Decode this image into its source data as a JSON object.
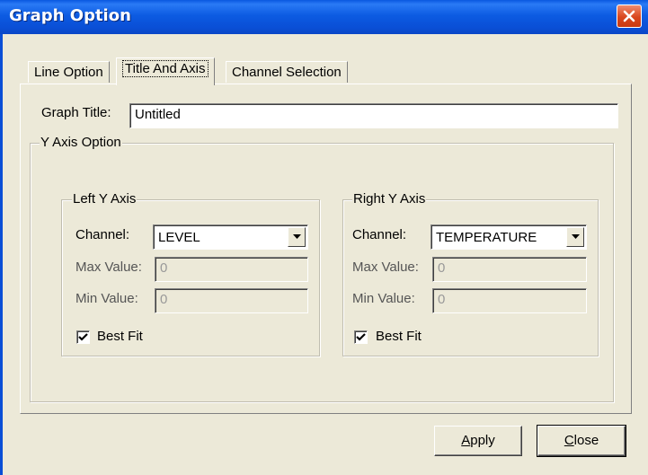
{
  "window": {
    "title": "Graph Option"
  },
  "tabs": [
    {
      "label": "Line Option",
      "active": false
    },
    {
      "label": "Title And Axis",
      "active": true
    },
    {
      "label": "Channel Selection",
      "active": false
    }
  ],
  "graph_title": {
    "label": "Graph Title:",
    "value": "Untitled"
  },
  "y_axis_option": {
    "label": "Y Axis Option",
    "left": {
      "label": "Left Y Axis",
      "channel_label": "Channel:",
      "channel_value": "LEVEL",
      "max_label": "Max Value:",
      "max_value": "0",
      "min_label": "Min Value:",
      "min_value": "0",
      "best_fit_label": "Best Fit",
      "best_fit_checked": true
    },
    "right": {
      "label": "Right Y Axis",
      "channel_label": "Channel:",
      "channel_value": "TEMPERATURE",
      "max_label": "Max Value:",
      "max_value": "0",
      "min_label": "Min Value:",
      "min_value": "0",
      "best_fit_label": "Best Fit",
      "best_fit_checked": true
    }
  },
  "buttons": {
    "apply": {
      "first": "A",
      "rest": "pply"
    },
    "close": {
      "first": "C",
      "rest": "lose"
    }
  },
  "icons": {
    "close": "close-icon",
    "dropdown": "chevron-down-icon",
    "check": "checkmark-icon"
  }
}
